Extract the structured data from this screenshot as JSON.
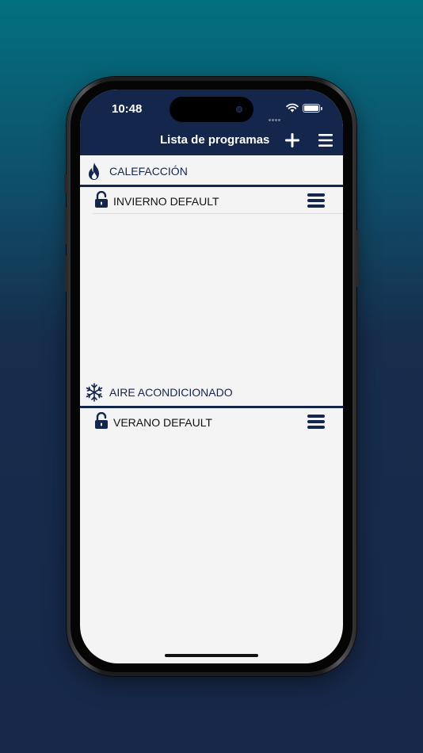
{
  "status_bar": {
    "time": "10:48"
  },
  "header": {
    "title": "Lista de programas",
    "add_icon": "plus-icon",
    "menu_icon": "hamburger-menu-icon"
  },
  "sections": [
    {
      "title": "CALEFACCIÓN",
      "icon": "flame-icon",
      "programs": [
        {
          "label": "INVIERNO DEFAULT",
          "lock_icon": "unlocked-padlock-icon",
          "menu_icon": "row-menu-icon"
        }
      ]
    },
    {
      "title": "AIRE ACONDICIONADO",
      "icon": "snowflake-icon",
      "programs": [
        {
          "label": "VERANO DEFAULT",
          "lock_icon": "unlocked-padlock-icon",
          "menu_icon": "row-menu-icon"
        }
      ]
    }
  ],
  "colors": {
    "primary": "#14264b",
    "list_background": "#f4f4f4",
    "background_gradient_top": "#03707f",
    "background_gradient_bottom": "#17284a"
  }
}
